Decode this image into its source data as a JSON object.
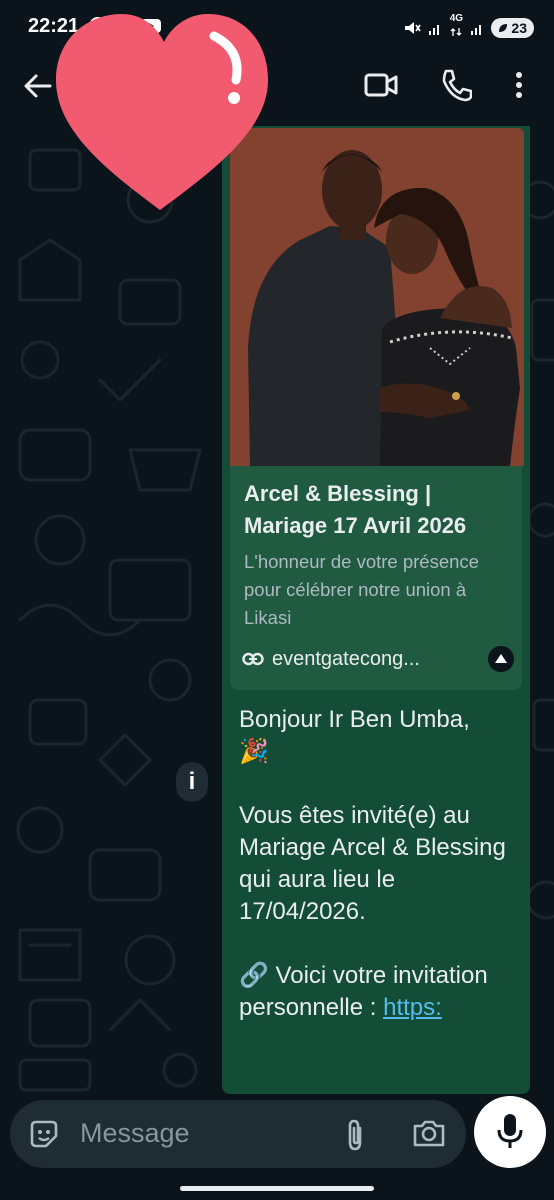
{
  "status_bar": {
    "time": "22:21",
    "network": "4G",
    "battery": "23"
  },
  "app_bar": {
    "icons": [
      "back-arrow-icon",
      "video-call-icon",
      "voice-call-icon",
      "more-vert-icon"
    ]
  },
  "message": {
    "link_preview": {
      "title": "Arcel & Blessing | Mariage 17 Avril 2026",
      "description": "L'honneur de votre présence pour célébrer notre union à Likasi",
      "url": "eventgatecong..."
    },
    "lines": [
      "Bonjour Ir Ben Umba,",
      "🎉",
      "",
      "Vous êtes invité(e) au Mariage Arcel & Blessing qui aura lieu le 17/04/2026.",
      "",
      "🔗 Voici votre invitation personnelle : "
    ],
    "link_text": "https:"
  },
  "info_badge": "i",
  "composer": {
    "placeholder": "Message"
  },
  "colors": {
    "background": "#0b141a",
    "bubble": "#144d37",
    "preview": "#1f5a41",
    "link": "#53bdeb",
    "heart": "#f25a70"
  }
}
